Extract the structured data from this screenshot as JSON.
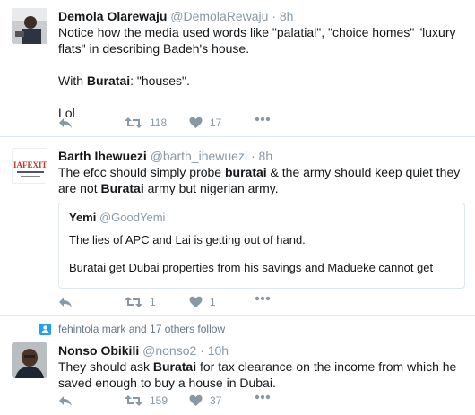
{
  "tweets": [
    {
      "name": "Demola Olarewaju",
      "handle": "@DemolaRewaju",
      "sep": "·",
      "time": "8h",
      "lines": [
        "Notice how the media used words like \"palatial\", \"choice homes\" \"luxury flats\" in describing Badeh's house.",
        "Buratai",
        ": \"houses\".",
        "With ",
        "Lol"
      ],
      "retweets": "118",
      "likes": "17"
    },
    {
      "name": "Barth Ihewuezi",
      "handle": "@barth_ihewuezi",
      "sep": "·",
      "time": "8h",
      "text_a": "The efcc should simply probe ",
      "text_b": "buratai",
      "text_c": " & the army should keep quiet they are not ",
      "text_d": "Buratai",
      "text_e": " army but nigerian army.",
      "avatar_text": "IAFEXIT",
      "quote": {
        "name": "Yemi",
        "handle": "@GoodYemi",
        "line1": "The lies of APC and Lai is getting out of hand.",
        "line2": "Buratai get Dubai properties from his savings and Madueke cannot get"
      },
      "retweets": "1",
      "likes": "1"
    },
    {
      "context": "fehintola mark and 17 others follow",
      "name": "Nonso Obikili",
      "handle": "@nonso2",
      "sep": "·",
      "time": "10h",
      "text_a": "They should ask ",
      "text_b": "Buratai",
      "text_c": " for tax clearance on the income from which he saved enough to buy a house in Dubai.",
      "retweets": "159",
      "likes": "37"
    }
  ],
  "colors": {
    "accent": "#1da1f2",
    "muted": "#8899a6",
    "border": "#e1e8ed"
  },
  "icons": [
    "reply-icon",
    "retweet-icon",
    "like-icon",
    "more-icon",
    "follow-context-icon"
  ]
}
